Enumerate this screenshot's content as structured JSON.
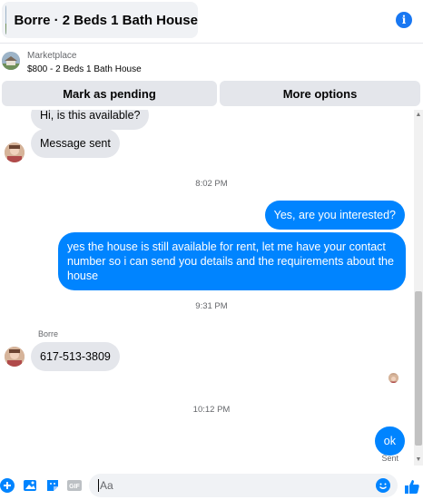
{
  "header": {
    "title": "Borre · 2 Beds 1 Bath House"
  },
  "marketplace": {
    "label": "Marketplace",
    "listing": "$800 - 2 Beds 1 Bath House"
  },
  "actions": {
    "mark_pending": "Mark as pending",
    "more_options": "More options"
  },
  "messages": {
    "partial_top": "Hi, is this available?",
    "msg_sent": "Message sent",
    "time1": "8:02 PM",
    "out1": "Yes, are you interested?",
    "out2": "yes the house is still available for rent, let me have your contact number so i can send you details and the requirements about the house",
    "time2": "9:31 PM",
    "sender_name": "Borre",
    "in_phone": "617-513-3809",
    "time3": "10:12 PM",
    "out3": "ok",
    "status": "Sent"
  },
  "composer": {
    "placeholder": "Aa"
  },
  "colors": {
    "accent": "#0084ff",
    "brand": "#1877f2",
    "incoming_bubble": "#e4e6eb"
  }
}
